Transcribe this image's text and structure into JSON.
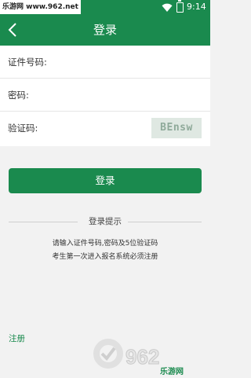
{
  "status_bar": {
    "watermark": "乐游网 www.962.net",
    "time": "9:14"
  },
  "app_bar": {
    "title": "登录"
  },
  "form": {
    "id_label": "证件号码:",
    "password_label": "密码:",
    "captcha_label": "验证码:",
    "captcha_text": "BEnsw"
  },
  "login_button": "登录",
  "tips": {
    "header": "登录提示",
    "lines": [
      "请输入证件号码,密码及5位验证码",
      "考生第一次进入报名系统必须注册"
    ]
  },
  "register_link": "注册",
  "logo": {
    "text": "962",
    "site": "乐游网"
  },
  "colors": {
    "primary": "#1a8a4e"
  }
}
